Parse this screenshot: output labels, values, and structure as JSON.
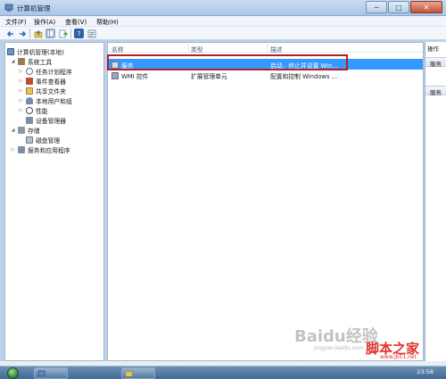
{
  "window": {
    "title": "计算机管理",
    "controls": {
      "minimize": "─",
      "maximize": "□",
      "close": "✕"
    }
  },
  "menubar": {
    "items": [
      "文件(F)",
      "操作(A)",
      "查看(V)",
      "帮助(H)"
    ]
  },
  "toolbar": {
    "buttons": [
      "back-icon",
      "forward-icon",
      "up-icon",
      "show-hide-tree-icon",
      "export-icon",
      "help-icon",
      "properties-icon"
    ]
  },
  "tree": {
    "root": "计算机管理(本地)",
    "system_tools": "系统工具",
    "task_scheduler": "任务计划程序",
    "event_viewer": "事件查看器",
    "shared_folders": "共享文件夹",
    "local_users": "本地用户和组",
    "performance": "性能",
    "device_manager": "设备管理器",
    "storage": "存储",
    "disk_management": "磁盘管理",
    "services_apps": "服务和应用程序"
  },
  "list": {
    "columns": {
      "name": "名称",
      "type": "类型",
      "description": "描述"
    },
    "rows": [
      {
        "name": "服务",
        "type": "",
        "description": "启动、终止并设置 Win..."
      },
      {
        "name": "WMI 控件",
        "type": "扩展管理单元",
        "description": "配置和控制 Windows ..."
      }
    ]
  },
  "actions": {
    "title": "操作",
    "section1": "服务",
    "section2": "服务"
  },
  "taskbar": {
    "clock": "23:58"
  },
  "watermarks": {
    "baidu": "Baidu经验",
    "baidu_sub": "jingyan.baidu.com",
    "jb51": "脚本之家",
    "jb51_sub": "www.jb51.net"
  },
  "colors": {
    "selection": "#3399ff",
    "highlight_border": "#b81d22",
    "taskbar": "#3f6a97"
  }
}
